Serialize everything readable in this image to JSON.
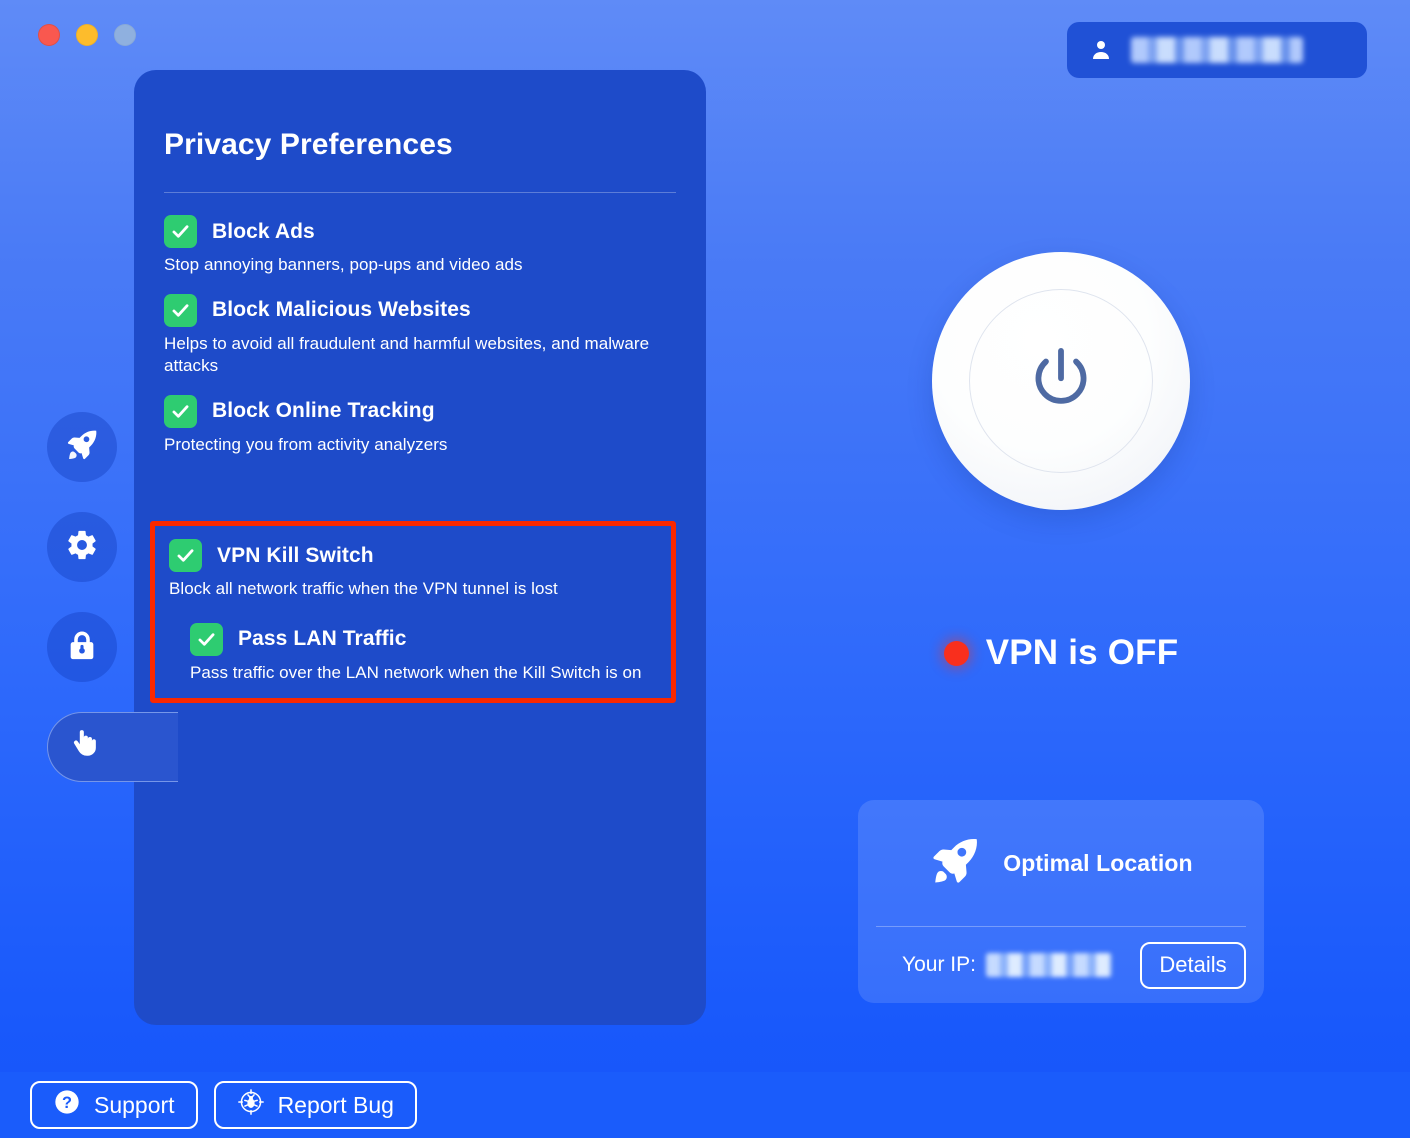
{
  "window": {
    "controls": [
      {
        "name": "close",
        "color": "#f9584f"
      },
      {
        "name": "minimize",
        "color": "#fdbc2c"
      },
      {
        "name": "zoom",
        "color": "#8fb0df"
      }
    ]
  },
  "account": {
    "icon": "person-icon",
    "name_redacted": "██████ █████"
  },
  "sidebar": {
    "items": [
      {
        "id": "locations",
        "icon": "rocket-icon",
        "active": false
      },
      {
        "id": "settings",
        "icon": "gear-icon",
        "active": false
      },
      {
        "id": "security",
        "icon": "lock-icon",
        "active": false
      },
      {
        "id": "privacy",
        "icon": "hand-icon",
        "active": true
      }
    ]
  },
  "preferences_card": {
    "title": "Privacy Preferences",
    "items": [
      {
        "id": "block-ads",
        "label": "Block Ads",
        "description": "Stop annoying banners, pop-ups and video ads",
        "checked": true
      },
      {
        "id": "block-malicious-websites",
        "label": "Block Malicious Websites",
        "description": "Helps to avoid all fraudulent and harmful websites, and malware attacks",
        "checked": true
      },
      {
        "id": "block-online-tracking",
        "label": "Block Online Tracking",
        "description": "Protecting you from activity analyzers",
        "checked": true
      }
    ],
    "highlighted_group": {
      "annotation_color": "#f92800",
      "primary": {
        "id": "vpn-kill-switch",
        "label": "VPN Kill Switch",
        "description": "Block all network traffic when the VPN tunnel is lost",
        "checked": true
      },
      "sub": {
        "id": "pass-lan-traffic",
        "label": "Pass LAN Traffic",
        "description": "Pass traffic over the LAN network when the Kill Switch is on",
        "checked": true
      }
    }
  },
  "connection": {
    "power_button_icon": "power-icon",
    "status_text": "VPN is OFF",
    "status_color": "#f92f1d"
  },
  "location_card": {
    "icon": "rocket-icon",
    "name": "Optimal Location",
    "ip_label": "Your IP:",
    "ip_value_redacted": "███.██.██.██",
    "details_button": "Details"
  },
  "footer": {
    "buttons": [
      {
        "id": "support",
        "label": "Support",
        "icon": "question-mark-icon"
      },
      {
        "id": "report-bug",
        "label": "Report Bug",
        "icon": "bug-target-icon"
      }
    ]
  },
  "theme": {
    "background_top": "#5f8bf7",
    "background_bottom": "#1554fa",
    "card": "#1e4bc9",
    "checkbox_green": "#2ecc71",
    "accent_white": "#ffffff"
  }
}
